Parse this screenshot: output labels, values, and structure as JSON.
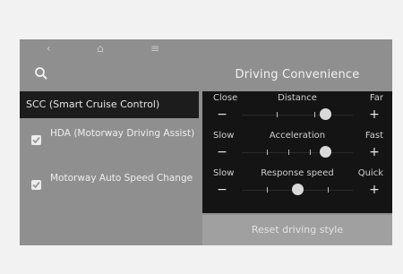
{
  "header": {
    "title": "Driving Convenience",
    "nav": {
      "back_icon": "back-arrow-icon",
      "home_icon": "home-icon",
      "menu_icon": "menu-icon"
    },
    "search_icon": "search-icon"
  },
  "left_panel": {
    "selected_item": "SCC (Smart Cruise Control)",
    "items": [
      {
        "label": "HDA (Motorway Driving Assist)",
        "checked": true
      },
      {
        "label": "Motorway Auto Speed Change",
        "checked": true
      }
    ]
  },
  "settings": [
    {
      "left_label": "Close",
      "title": "Distance",
      "right_label": "Far",
      "level_fraction": 0.75
    },
    {
      "left_label": "Slow",
      "title": "Acceleration",
      "right_label": "Fast",
      "level_fraction": 0.75
    },
    {
      "left_label": "Slow",
      "title": "Response speed",
      "right_label": "Quick",
      "level_fraction": 0.5
    }
  ],
  "reset_label": "Reset driving style",
  "colors": {
    "screen_bg": "#8f8f8f",
    "selected_bg": "#1c1c1c",
    "panel_bg": "#141414"
  }
}
